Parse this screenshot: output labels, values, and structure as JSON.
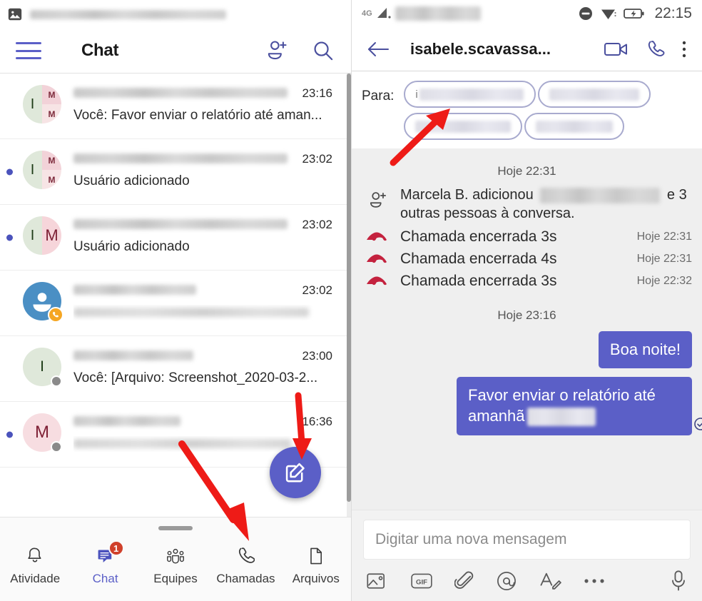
{
  "left": {
    "notification": {
      "icon": "image-icon",
      "text_redacted": true
    },
    "header": {
      "title": "Chat",
      "menu_icon": "hamburger-menu-icon",
      "add_person_icon": "add-person-icon",
      "search_icon": "search-icon"
    },
    "chats": [
      {
        "avatar": {
          "type": "split3",
          "initials": [
            "I",
            "M",
            "M"
          ]
        },
        "name_redacted": true,
        "preview": "Você: Favor enviar o relatório até aman...",
        "time": "23:16",
        "unread": false,
        "presence": null
      },
      {
        "avatar": {
          "type": "split3",
          "initials": [
            "I",
            "M",
            "M"
          ]
        },
        "name_redacted": true,
        "preview": "Usuário adicionado",
        "time": "23:02",
        "unread": true,
        "presence": null
      },
      {
        "avatar": {
          "type": "split2",
          "initials": [
            "I",
            "M"
          ]
        },
        "name_redacted": true,
        "preview": "Usuário adicionado",
        "time": "23:02",
        "unread": true,
        "presence": null
      },
      {
        "avatar": {
          "type": "person-blue",
          "badge": "missed-call"
        },
        "name_redacted": true,
        "preview": "",
        "preview_redacted": true,
        "time": "23:02",
        "unread": false,
        "presence": null
      },
      {
        "avatar": {
          "type": "solid-green",
          "initials": [
            "I"
          ]
        },
        "name_redacted": true,
        "preview": "Você: [Arquivo: Screenshot_2020-03-2...",
        "time": "23:00",
        "unread": false,
        "presence": "offline"
      },
      {
        "avatar": {
          "type": "solid-pink",
          "initials": [
            "M"
          ]
        },
        "name_redacted": true,
        "preview": "",
        "preview_redacted": true,
        "time": "16:36",
        "unread": true,
        "presence": "offline"
      }
    ],
    "fab": {
      "icon": "compose-icon",
      "color": "#5b5fc7"
    },
    "bottom_nav": [
      {
        "label": "Atividade",
        "icon": "bell-icon",
        "active": false,
        "badge": null
      },
      {
        "label": "Chat",
        "icon": "chat-bubble-icon",
        "active": true,
        "badge": "1"
      },
      {
        "label": "Equipes",
        "icon": "teams-people-icon",
        "active": false,
        "badge": null
      },
      {
        "label": "Chamadas",
        "icon": "phone-icon",
        "active": false,
        "badge": null
      },
      {
        "label": "Arquivos",
        "icon": "file-icon",
        "active": false,
        "badge": null
      }
    ]
  },
  "right": {
    "status_bar": {
      "network": "4G",
      "signal_icon": "signal-bars-icon",
      "carrier_redacted": true,
      "dnd_icon": "do-not-disturb-icon",
      "wifi_icon": "wifi-icon",
      "battery_icon": "battery-charging-icon",
      "time": "22:15"
    },
    "conversation_header": {
      "back_icon": "back-arrow-icon",
      "title": "isabele.scavassa...",
      "video_icon": "video-call-icon",
      "call_icon": "phone-call-icon",
      "more_icon": "more-vertical-icon"
    },
    "recipients": {
      "label": "Para:",
      "chips": [
        {
          "text_prefix": "i",
          "redacted": true
        },
        {
          "text_prefix": "",
          "redacted": true
        },
        {
          "text_prefix": "",
          "redacted": true
        },
        {
          "text_prefix": "",
          "redacted": true
        }
      ]
    },
    "thread": {
      "daystamp_1": "Hoje 22:31",
      "system_message": {
        "icon": "add-person-icon",
        "text_before": "Marcela B. adicionou",
        "text_after": "e 3 outras pessoas à conversa.",
        "name_redacted": true
      },
      "calls": [
        {
          "icon": "call-ended-icon",
          "text": "Chamada encerrada 3s",
          "time": "Hoje 22:31"
        },
        {
          "icon": "call-ended-icon",
          "text": "Chamada encerrada 4s",
          "time": "Hoje 22:31"
        },
        {
          "icon": "call-ended-icon",
          "text": "Chamada encerrada 3s",
          "time": "Hoje 22:32"
        }
      ],
      "daystamp_2": "Hoje 23:16",
      "messages": [
        {
          "text": "Boa noite!",
          "from_me": true,
          "redacted_tail": false
        },
        {
          "text": "Favor enviar o relatório até amanhã",
          "from_me": true,
          "redacted_tail": true,
          "read_receipt": "read-check-icon"
        }
      ]
    },
    "composer": {
      "placeholder": "Digitar uma nova mensagem",
      "value": "",
      "tools": [
        {
          "icon": "image-icon",
          "label": ""
        },
        {
          "icon": "gif-icon",
          "label": "GIF"
        },
        {
          "icon": "attachment-clip-icon",
          "label": ""
        },
        {
          "icon": "mention-at-icon",
          "label": ""
        },
        {
          "icon": "format-text-icon",
          "label": ""
        },
        {
          "icon": "more-horizontal-icon",
          "label": ""
        },
        {
          "icon": "microphone-icon",
          "label": ""
        }
      ]
    }
  },
  "annotations": {
    "arrow_color": "#ee1b17",
    "arrows": [
      {
        "name": "arrow-to-compose-fab"
      },
      {
        "name": "arrow-to-calls-tab"
      },
      {
        "name": "arrow-to-recipient-chips"
      }
    ]
  }
}
